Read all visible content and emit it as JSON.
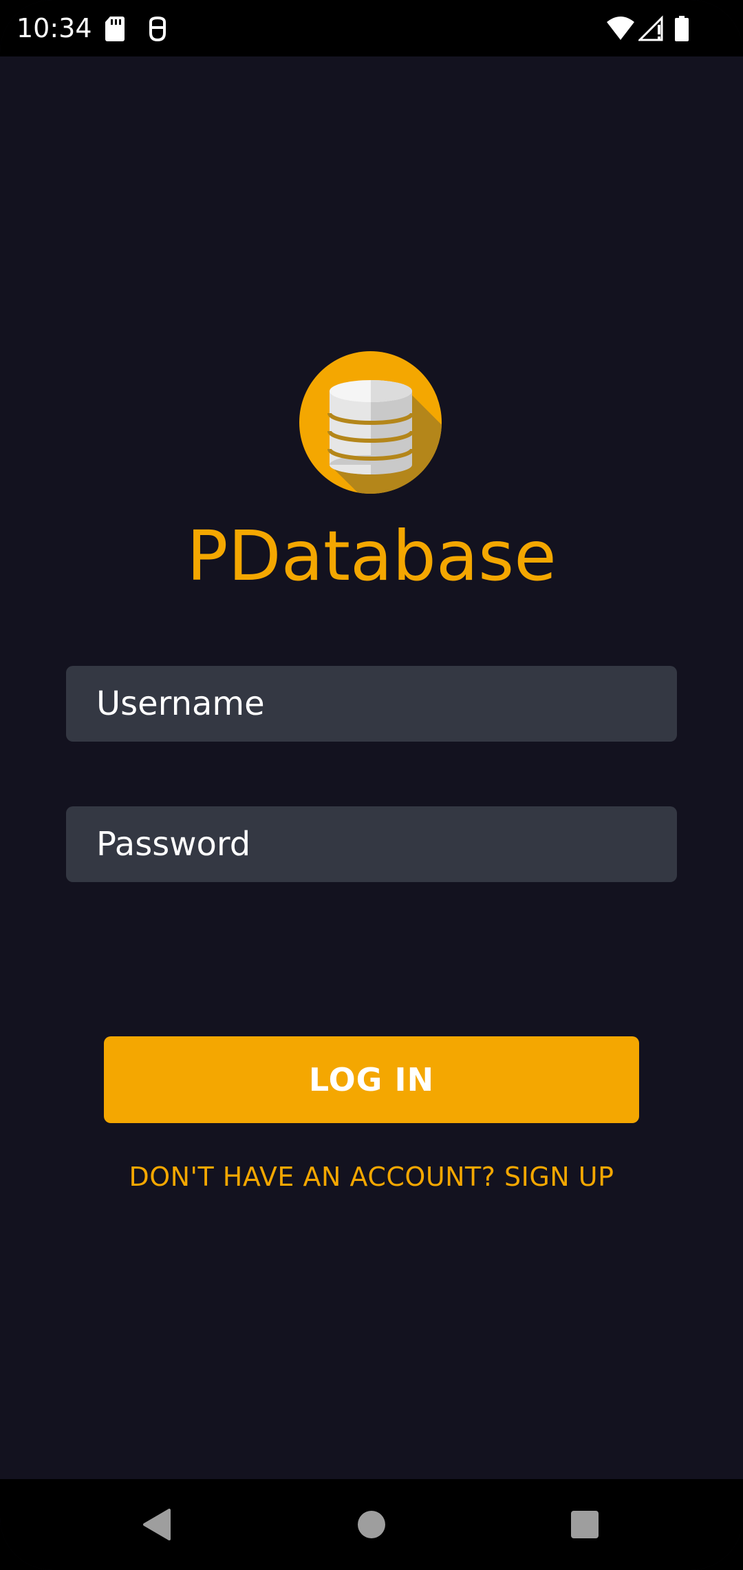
{
  "status_bar": {
    "time": "10:34",
    "icons": [
      "sd-card-icon",
      "assistant-icon",
      "wifi-icon",
      "signal-icon",
      "battery-icon"
    ]
  },
  "app": {
    "title": "PDatabase",
    "logo_icon": "database-icon"
  },
  "form": {
    "username_placeholder": "Username",
    "password_placeholder": "Password",
    "login_label": "LOG IN",
    "signup_label": "DON'T HAVE AN ACCOUNT? SIGN UP"
  },
  "nav": {
    "icons": [
      "back-icon",
      "home-icon",
      "recents-icon"
    ]
  },
  "colors": {
    "background": "#13121f",
    "accent": "#f4a701",
    "field": "#343843"
  }
}
